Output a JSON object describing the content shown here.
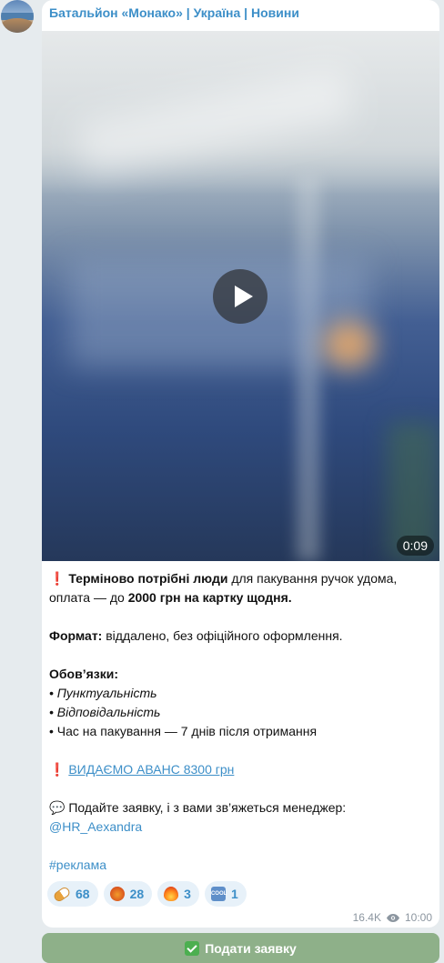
{
  "channel": {
    "name": "Батальйон «Монако» | Україна | Новини"
  },
  "video": {
    "duration": "0:09"
  },
  "post": {
    "line1_excl": "❗",
    "line1_bold": "Терміново потрібні люди",
    "line1_rest": " для пакування ручок удома, оплата — до ",
    "line1_bold2": "2000 грн на картку щодня.",
    "format_label": "Формат:",
    "format_value": " віддалено, без офіційного оформлення.",
    "duties_title": "Обов’язки:",
    "duty1": "• Пунктуальність",
    "duty2": "• Відповідальність",
    "duty3": "• Час на пакування — 7 днів після отримання",
    "advance_excl": "❗",
    "advance_link": "ВИДАЄМО АВАНС 8300 грн",
    "apply_emoji": "💬",
    "apply_text": " Подайте заявку, і з вами зв’яжеться менеджер:",
    "manager": "@HR_Aexandra",
    "hashtag": "#реклама"
  },
  "reactions": [
    {
      "icon": "pill-icon",
      "count": "68"
    },
    {
      "icon": "angry-face-icon",
      "count": "28"
    },
    {
      "icon": "fire-icon",
      "count": "3"
    },
    {
      "icon": "cool-icon",
      "count": "1",
      "label": "COOL"
    }
  ],
  "meta": {
    "views": "16.4K",
    "time": "10:00"
  },
  "cta": {
    "label": "Подати заявку"
  }
}
